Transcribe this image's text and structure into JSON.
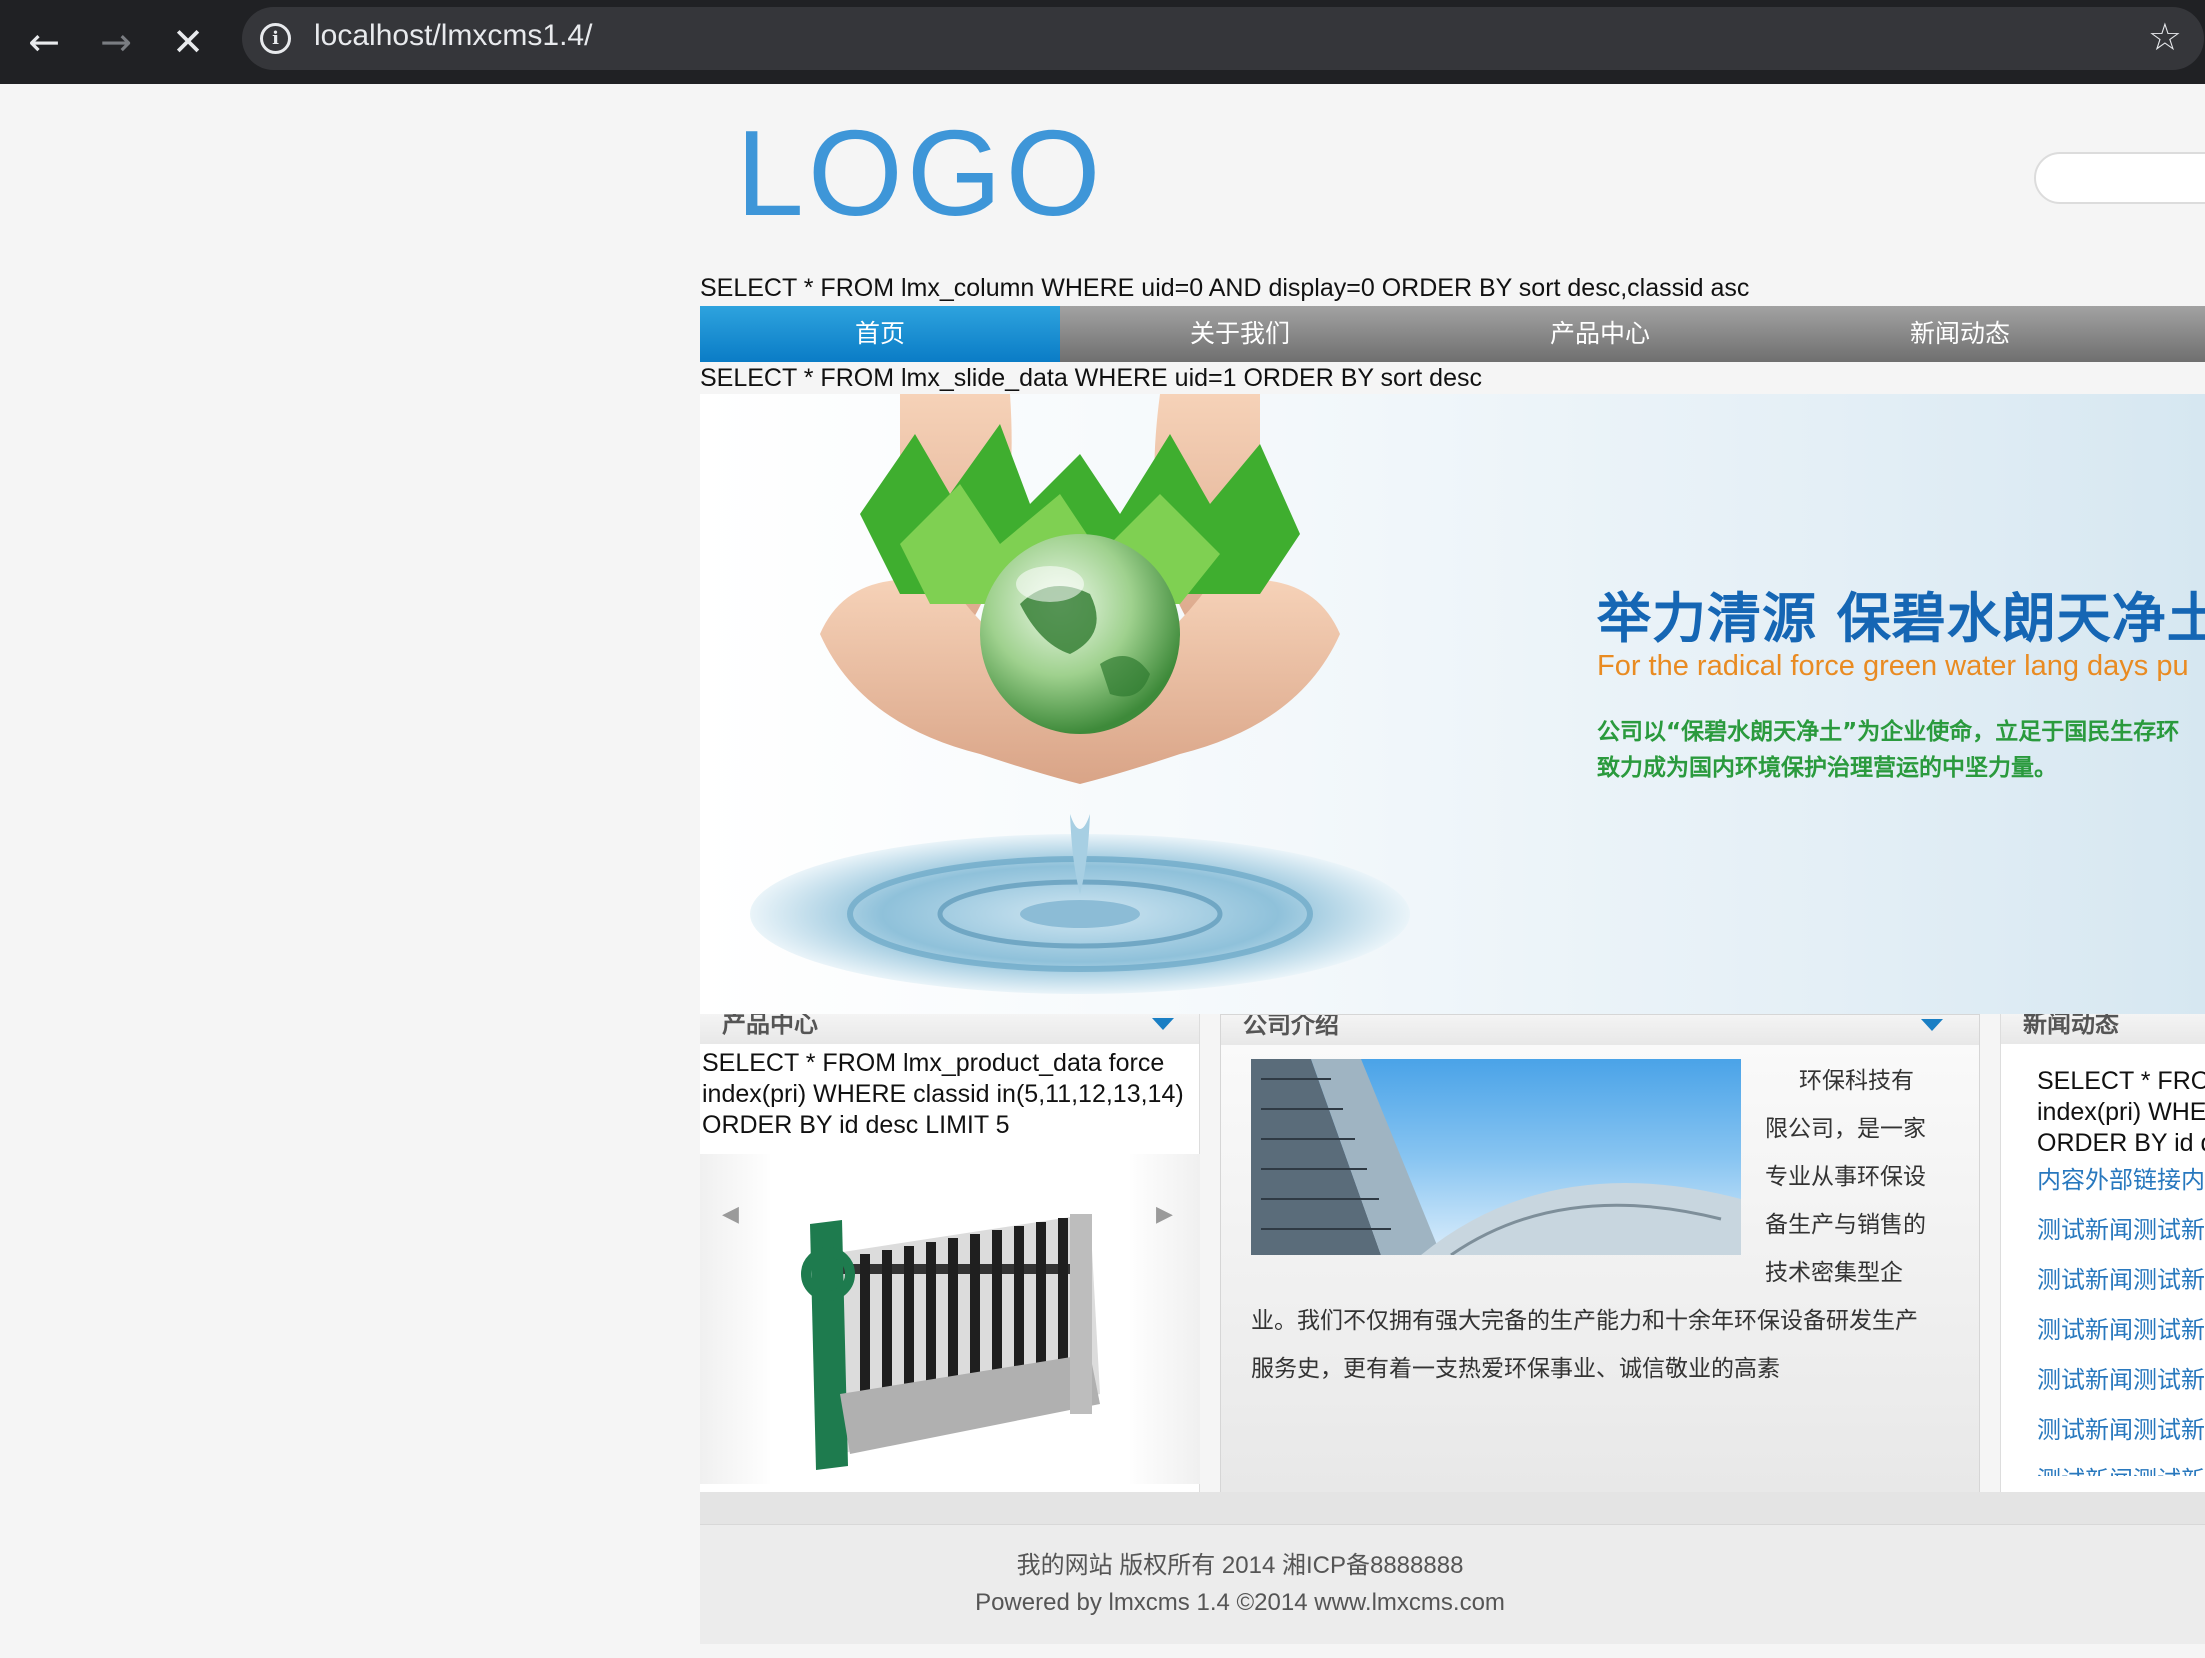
{
  "browser": {
    "url": "localhost/lmxcms1.4/",
    "icons": {
      "back": "arrow-left-icon",
      "forward": "arrow-right-icon",
      "stop": "close-icon",
      "info": "info-icon",
      "bookmark": "star-icon"
    }
  },
  "header": {
    "logo_text": "LOGO"
  },
  "debug": {
    "column_sql": "SELECT * FROM lmx_column WHERE uid=0 AND display=0 ORDER BY sort desc,classid asc",
    "slide_sql": "SELECT * FROM lmx_slide_data WHERE uid=1 ORDER BY sort desc"
  },
  "nav": {
    "items": [
      {
        "label": "首页",
        "active": true
      },
      {
        "label": "关于我们",
        "active": false
      },
      {
        "label": "产品中心",
        "active": false
      },
      {
        "label": "新闻动态",
        "active": false
      }
    ]
  },
  "banner": {
    "title": "举力清源 保碧水朗天净土",
    "subtitle": "For the radical force green water lang days pu",
    "desc_line1": "公司以“保碧水朗天净土”为企业使命，立足于国民生存环",
    "desc_line2": "致力成为国内环境保护治理营运的中坚力量。"
  },
  "products": {
    "heading": "产品中心",
    "sql_line1": "SELECT * FROM lmx_product_data force",
    "sql_line2": "index(pri) WHERE classid in(5,11,12,13,14)",
    "sql_line3": "ORDER BY id desc LIMIT 5"
  },
  "about": {
    "heading": "公司介绍",
    "side_lines": [
      "环保科技有",
      "限公司，是一家",
      "专业从事环保设",
      "备生产与销售的",
      "技术密集型企"
    ],
    "full_lines": [
      "业。我们不仅拥有强大完备的生产能力和十余年环保设备研发生产",
      "服务史，更有着一支热爱环保事业、诚信敬业的高素"
    ]
  },
  "news": {
    "heading": "新闻动态",
    "sql_line1": "SELECT * FROM",
    "sql_line2": "index(pri) WHE",
    "sql_line3": "ORDER BY id d",
    "links": [
      "内容外部链接内",
      "测试新闻测试新",
      "测试新闻测试新",
      "测试新闻测试新",
      "测试新闻测试新",
      "测试新闻测试新",
      "测试新闻测试新"
    ]
  },
  "footer": {
    "line1": "我的网站 版权所有 2014 湘ICP备8888888",
    "line2": "Powered by lmxcms 1.4 ©2014 www.lmxcms.com"
  },
  "colors": {
    "chrome_bg": "#202124",
    "menu_active": "#0a7cc6",
    "logo": "#3e96d8",
    "link": "#2878be",
    "banner_title": "#1566b4",
    "banner_sub": "#e98b22",
    "banner_desc": "#2a9a3d"
  }
}
